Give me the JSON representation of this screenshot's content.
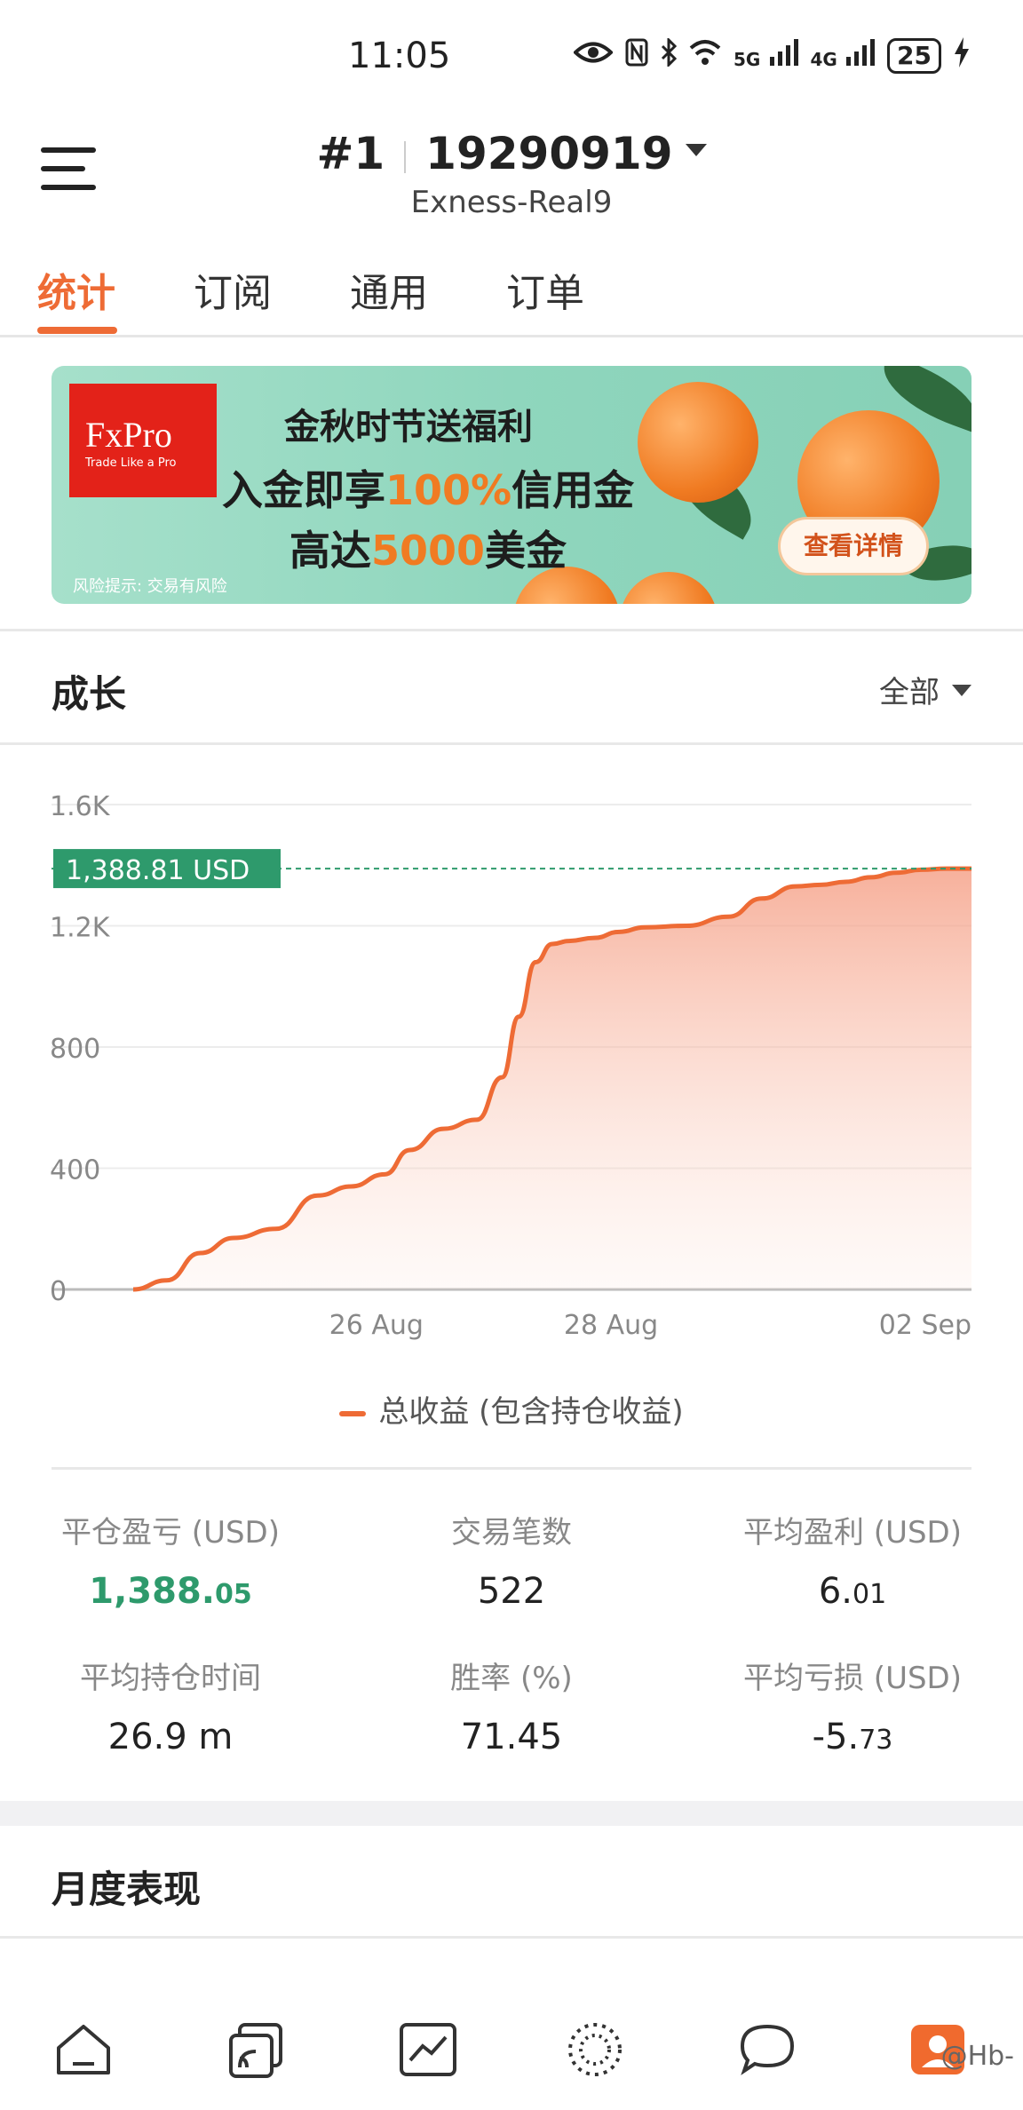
{
  "status_bar": {
    "time": "11:05",
    "battery": "25",
    "net_5g": "5G",
    "net_4g": "4G",
    "icons": [
      "eye-icon",
      "nfc-icon",
      "bluetooth-icon",
      "wifi-icon",
      "signal-5g-icon",
      "signal-4g-icon",
      "battery-icon",
      "charging-icon"
    ]
  },
  "header": {
    "account_index": "#1",
    "account_number": "19290919",
    "server": "Exness-Real9"
  },
  "tabs": [
    {
      "label": "统计",
      "active": true
    },
    {
      "label": "订阅",
      "active": false
    },
    {
      "label": "通用",
      "active": false
    },
    {
      "label": "订单",
      "active": false
    }
  ],
  "banner": {
    "brand": "FxPro",
    "brand_tagline": "Trade Like a Pro",
    "line1": "金秋时节送福利",
    "line2_pre": "入金即享",
    "line2_hl": "100%",
    "line2_post": "信用金",
    "line3_pre": "高达",
    "line3_hl": "5000",
    "line3_post": "美金",
    "button": "查看详情",
    "risk_note": "风险提示: 交易有风险"
  },
  "growth": {
    "title": "成长",
    "filter": "全部"
  },
  "chart_data": {
    "type": "area",
    "series": [
      {
        "name": "总收益 (包含持仓收益)",
        "color": "#ee6b35",
        "x": [
          0,
          0.04,
          0.08,
          0.12,
          0.17,
          0.22,
          0.26,
          0.3,
          0.33,
          0.37,
          0.41,
          0.44,
          0.46,
          0.48,
          0.5,
          0.52,
          0.55,
          0.58,
          0.61,
          0.66,
          0.71,
          0.75,
          0.79,
          0.82,
          0.85,
          0.88,
          0.91,
          0.94,
          0.97,
          1.0
        ],
        "values": [
          0,
          30,
          120,
          170,
          200,
          310,
          340,
          380,
          460,
          530,
          560,
          700,
          900,
          1080,
          1140,
          1150,
          1160,
          1180,
          1195,
          1200,
          1230,
          1290,
          1330,
          1335,
          1345,
          1360,
          1375,
          1385,
          1388.81,
          1388.81
        ]
      }
    ],
    "yticks": [
      "1.6K",
      "1.2K",
      "800",
      "400",
      "0"
    ],
    "ytick_values": [
      1600,
      1200,
      800,
      400,
      0
    ],
    "ylim": [
      0,
      1600
    ],
    "xticks": [
      "26 Aug",
      "28 Aug",
      "02 Sep"
    ],
    "current_label": "1,388.81 USD",
    "current_value": 1388.81,
    "current_color": "#2e9a6c",
    "grid": true,
    "legend_position": "bottom"
  },
  "stats": [
    {
      "label": "平仓盈亏 (USD)",
      "main": "1,388.",
      "frac": "05",
      "green": true
    },
    {
      "label": "交易笔数",
      "main": "522",
      "frac": "",
      "green": false
    },
    {
      "label": "平均盈利 (USD)",
      "main": "6.",
      "frac": "01",
      "green": false
    },
    {
      "label": "平均持仓时间",
      "main": "26.9 m",
      "frac": "",
      "green": false
    },
    {
      "label": "胜率 (%)",
      "main": "71.45",
      "frac": "",
      "green": false
    },
    {
      "label": "平均亏损 (USD)",
      "main": "-5.",
      "frac": "73",
      "green": false
    }
  ],
  "monthly": {
    "title": "月度表现"
  },
  "bottom_nav": {
    "items": [
      "home-icon",
      "copy-icon",
      "chart-icon",
      "community-icon",
      "chat-icon",
      "profile-icon"
    ],
    "watermark": "@Hb-"
  }
}
